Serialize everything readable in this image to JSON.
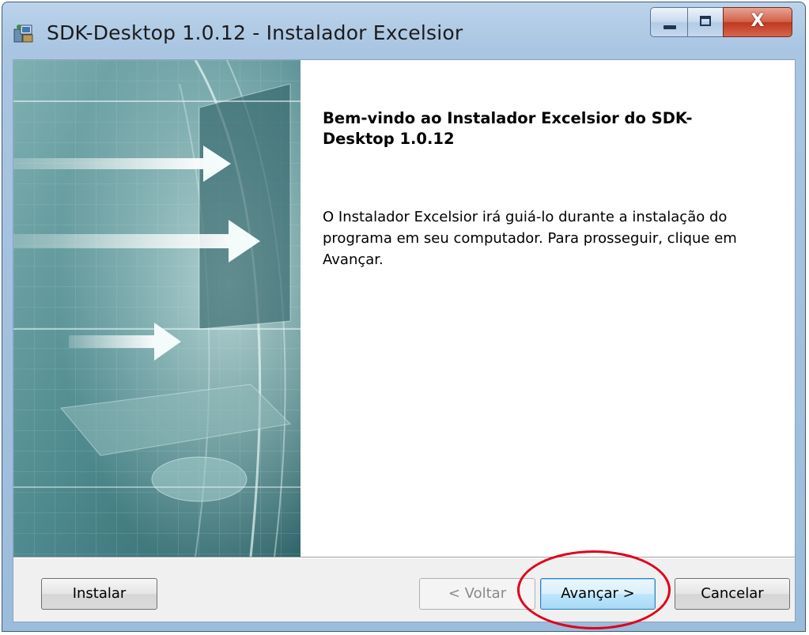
{
  "window": {
    "title": "SDK-Desktop 1.0.12 - Instalador Excelsior",
    "close_glyph": "X"
  },
  "content": {
    "welcome_title": "Bem-vindo ao Instalador Excelsior do SDK-Desktop 1.0.12",
    "welcome_body": "O Instalador Excelsior irá guiá-lo durante a instalação do programa em seu computador. Para prosseguir, clique em Avançar."
  },
  "buttons": {
    "install": "Instalar",
    "back": "< Voltar",
    "next": "Avançar >",
    "cancel": "Cancelar"
  },
  "icons": {
    "app": "installer-app-icon",
    "minimize": "minimize-icon",
    "maximize": "maximize-icon",
    "close": "close-icon"
  },
  "colors": {
    "highlight_ring": "#e0001a",
    "banner_teal": "#4e8a8e",
    "default_button_border": "#3c7fb1"
  }
}
